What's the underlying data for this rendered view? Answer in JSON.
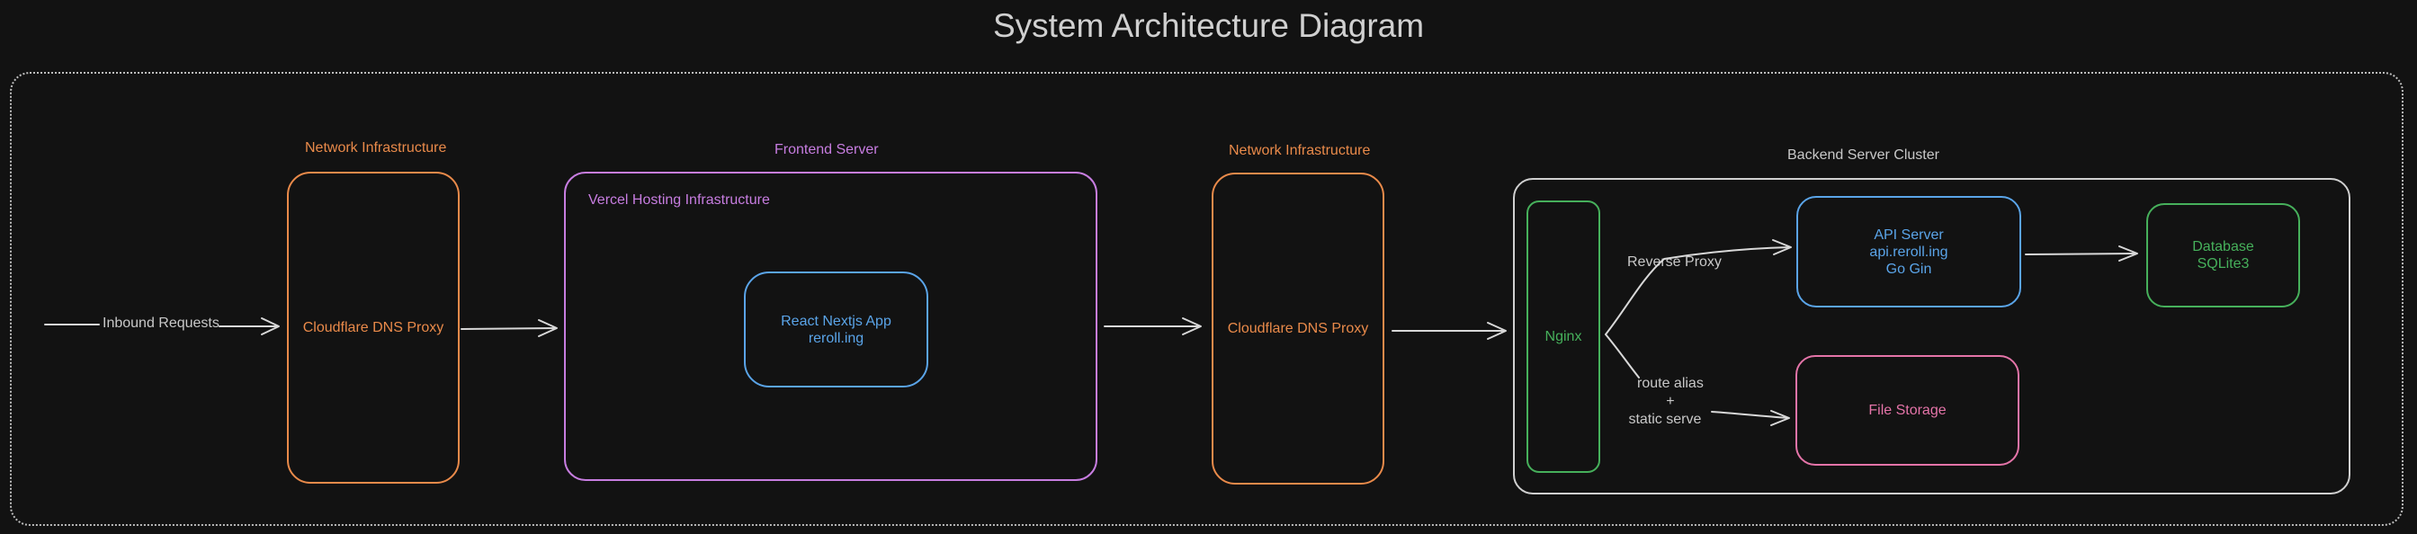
{
  "title": "System Architecture Diagram",
  "labels": {
    "inbound": "Inbound Requests",
    "network_infra_1": "Network Infrastructure",
    "frontend_server": "Frontend Server",
    "vercel_hosting": "Vercel Hosting Infrastructure",
    "network_infra_2": "Network Infrastructure",
    "backend_cluster": "Backend Server Cluster",
    "reverse_proxy": "Reverse Proxy",
    "route_alias_lines": [
      "route alias",
      "+",
      "static serve"
    ]
  },
  "nodes": {
    "cloudflare_1": "Cloudflare DNS Proxy",
    "react_app": [
      "React Nextjs App",
      "reroll.ing"
    ],
    "cloudflare_2": "Cloudflare DNS Proxy",
    "nginx": "Nginx",
    "api_server": [
      "API Server",
      "api.reroll.ing",
      "Go Gin"
    ],
    "database": [
      "Database",
      "SQLite3"
    ],
    "file_storage": "File Storage"
  },
  "colors": {
    "background": "#121212",
    "orange": "#e98a4a",
    "violet": "#c77de0",
    "blue": "#5aa4e8",
    "green": "#46b05b",
    "pink": "#e474a8",
    "gray": "#c8c8c8"
  }
}
